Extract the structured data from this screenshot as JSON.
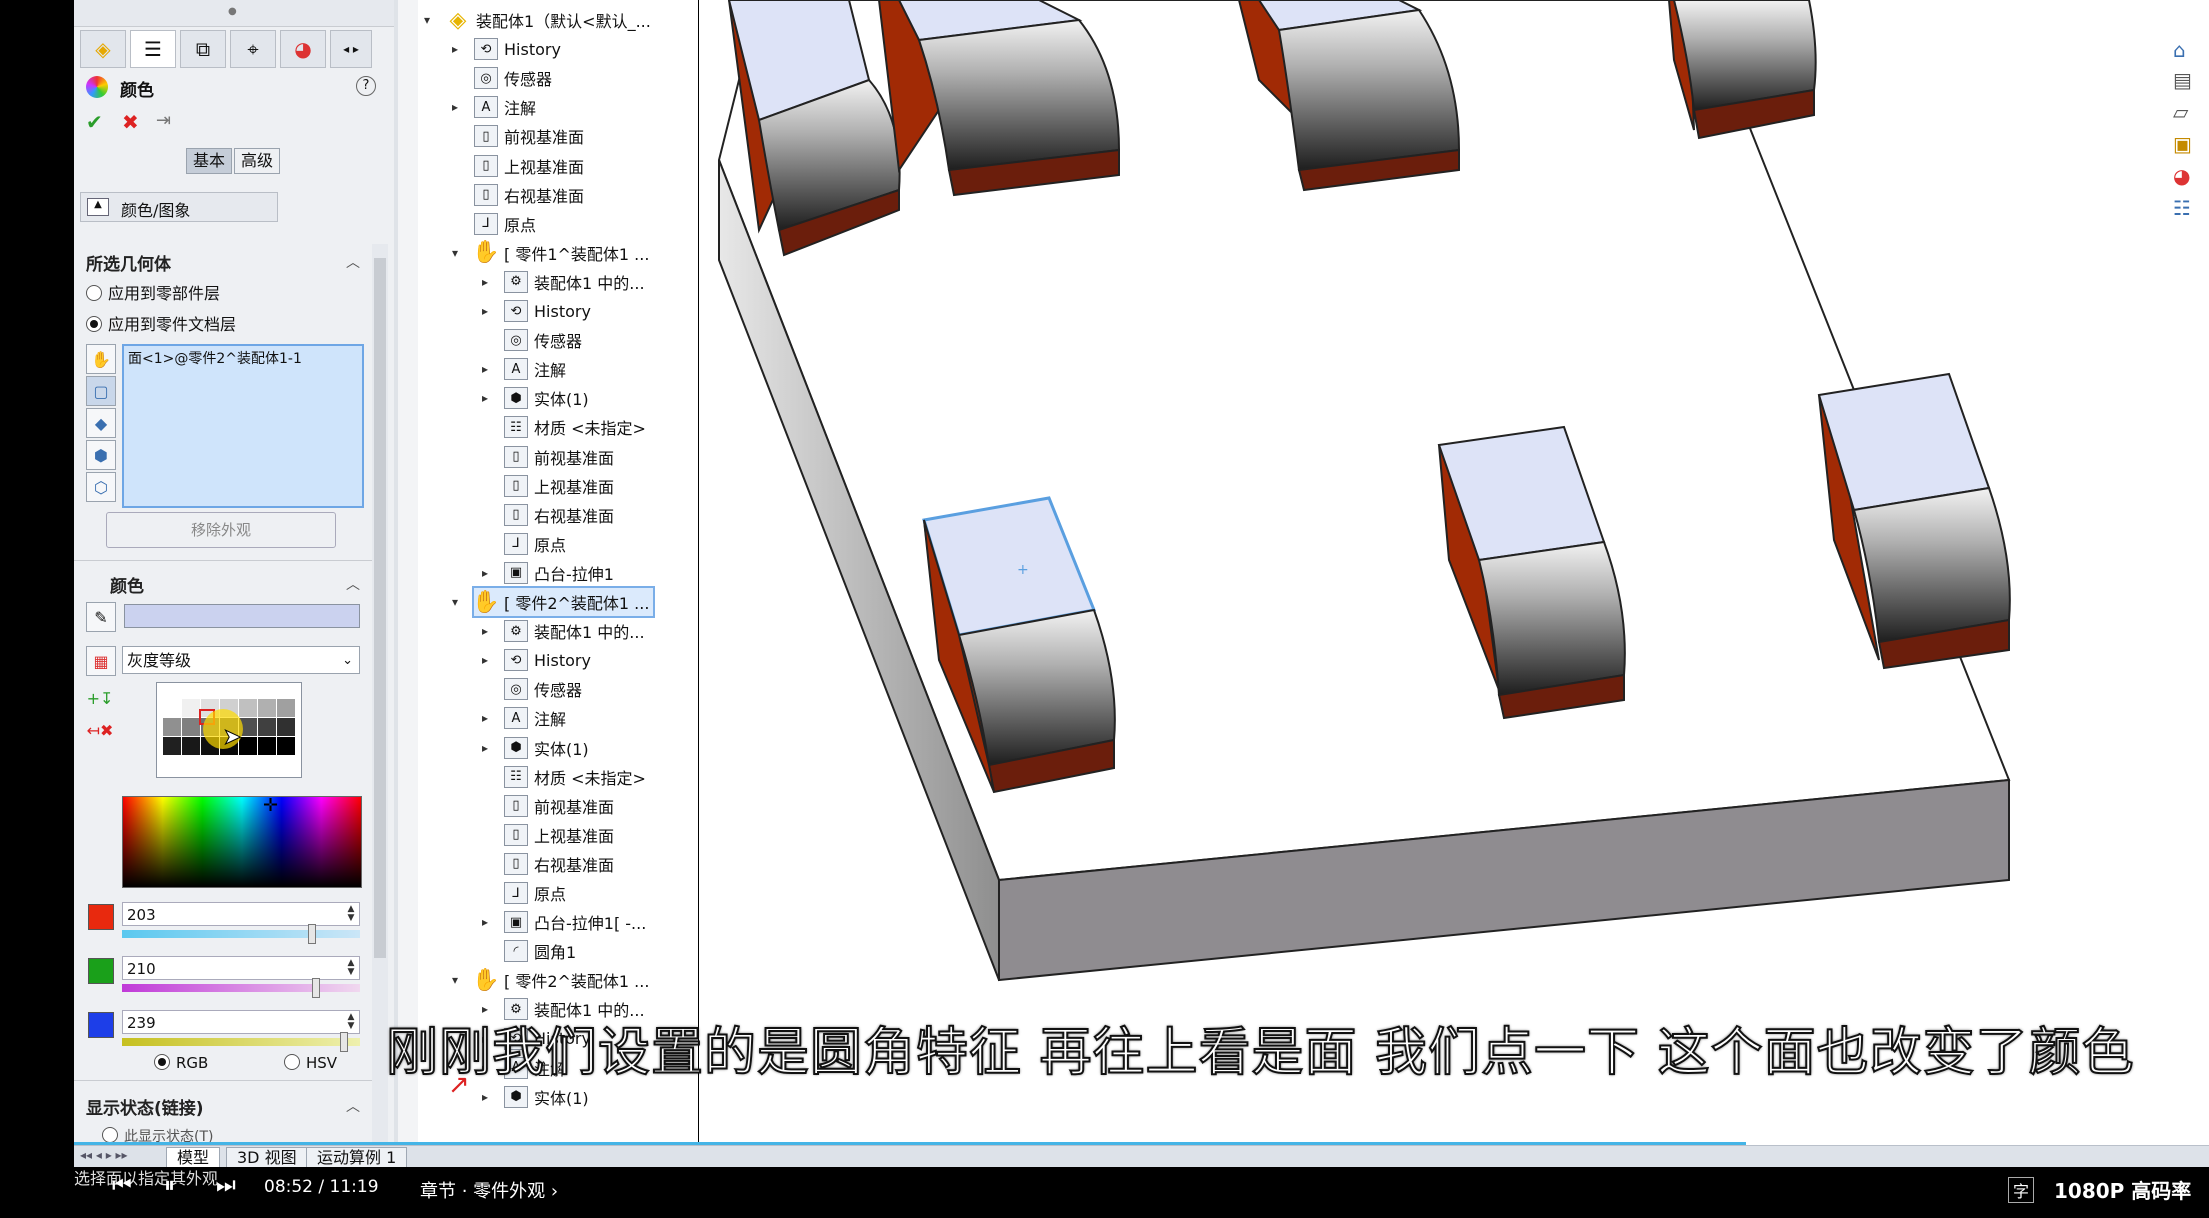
{
  "property_manager": {
    "title": "颜色",
    "ok": "✔",
    "cancel": "✖",
    "pin": "⇥",
    "tabs_basic": "基本",
    "tabs_advanced": "高级",
    "color_image_tab": "颜色/图象",
    "selected_geometry": {
      "heading": "所选几何体",
      "opt_component": "应用到零部件层",
      "opt_part": "应用到零件文档层",
      "selection": "面<1>@零件2^装配体1-1",
      "remove_button": "移除外观"
    },
    "color": {
      "heading": "颜色",
      "palette": "灰度等级",
      "r": "203",
      "g": "210",
      "b": "239",
      "r_level": 0.8,
      "g_level": 0.82,
      "b_level": 0.94,
      "mode_rgb": "RGB",
      "mode_hsv": "HSV",
      "swatch_hex": "#cbd2ef"
    },
    "display_state": {
      "heading": "显示状态(链接)",
      "option": "此显示状态(T)"
    }
  },
  "tree": {
    "items": [
      {
        "label": "装配体1（默认<默认_...",
        "icon": "assembly-icon"
      },
      {
        "label": "History",
        "icon": "history-icon"
      },
      {
        "label": "传感器",
        "icon": "sensor-icon"
      },
      {
        "label": "注解",
        "icon": "annotation-icon"
      },
      {
        "label": "前视基准面",
        "icon": "plane-icon"
      },
      {
        "label": "上视基准面",
        "icon": "plane-icon"
      },
      {
        "label": "右视基准面",
        "icon": "plane-icon"
      },
      {
        "label": "原点",
        "icon": "origin-icon"
      },
      {
        "label": "[ 零件1^装配体1 ...",
        "icon": "part-icon"
      },
      {
        "label": "装配体1 中的...",
        "icon": "config-icon"
      },
      {
        "label": "History",
        "icon": "history-icon"
      },
      {
        "label": "传感器",
        "icon": "sensor-icon"
      },
      {
        "label": "注解",
        "icon": "annotation-icon"
      },
      {
        "label": "实体(1)",
        "icon": "solid-body-icon"
      },
      {
        "label": "材质 <未指定>",
        "icon": "material-icon"
      },
      {
        "label": "前视基准面",
        "icon": "plane-icon"
      },
      {
        "label": "上视基准面",
        "icon": "plane-icon"
      },
      {
        "label": "右视基准面",
        "icon": "plane-icon"
      },
      {
        "label": "原点",
        "icon": "origin-icon"
      },
      {
        "label": "凸台-拉伸1",
        "icon": "extrude-icon"
      },
      {
        "label": "[ 零件2^装配体1 ...",
        "icon": "part-icon"
      },
      {
        "label": "装配体1 中的...",
        "icon": "config-icon"
      },
      {
        "label": "History",
        "icon": "history-icon"
      },
      {
        "label": "传感器",
        "icon": "sensor-icon"
      },
      {
        "label": "注解",
        "icon": "annotation-icon"
      },
      {
        "label": "实体(1)",
        "icon": "solid-body-icon"
      },
      {
        "label": "材质 <未指定>",
        "icon": "material-icon"
      },
      {
        "label": "前视基准面",
        "icon": "plane-icon"
      },
      {
        "label": "上视基准面",
        "icon": "plane-icon"
      },
      {
        "label": "右视基准面",
        "icon": "plane-icon"
      },
      {
        "label": "原点",
        "icon": "origin-icon"
      },
      {
        "label": "凸台-拉伸1[ -...",
        "icon": "extrude-icon"
      },
      {
        "label": "圆角1",
        "icon": "fillet-icon"
      },
      {
        "label": "[ 零件2^装配体1 ...",
        "icon": "part-icon"
      },
      {
        "label": "装配体1 中的...",
        "icon": "config-icon"
      },
      {
        "label": "History",
        "icon": "history-icon"
      },
      {
        "label": "注解",
        "icon": "annotation-icon"
      },
      {
        "label": "实体(1)",
        "icon": "solid-body-icon"
      }
    ]
  },
  "subtitle": "刚刚我们设置的是圆角特征 再往上看是面 我们点一下 这个面也改变了颜色",
  "bottom_tabs": [
    "模型",
    "3D 视图",
    "运动算例 1"
  ],
  "status_hint": "选择面以指定其外观",
  "player": {
    "time": "08:52 / 11:19",
    "chapter": "章节 · 零件外观 ›",
    "quality": "1080P 高码率",
    "progress": 0.783
  }
}
